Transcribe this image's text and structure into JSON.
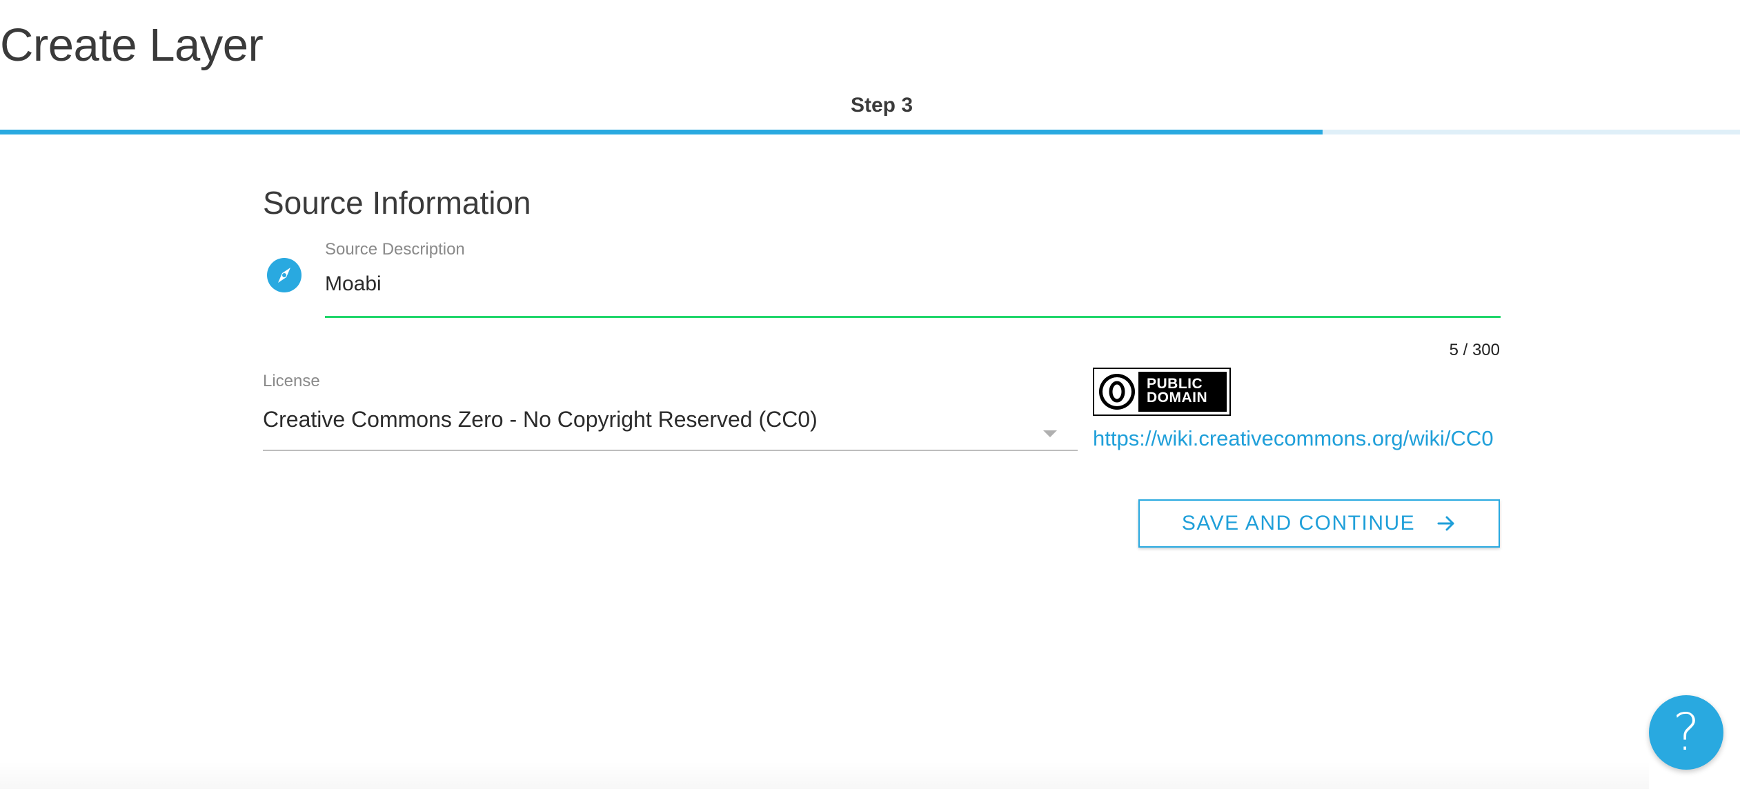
{
  "page": {
    "title": "Create Layer"
  },
  "stepper": {
    "label": "Step 3",
    "progress_fraction": 0.76,
    "fill_color": "#29a9e0",
    "track_color": "#dfeff8"
  },
  "section": {
    "title": "Source Information"
  },
  "source_description": {
    "icon": "compass-icon",
    "label": "Source Description",
    "value": "Moabi",
    "counter": "5 / 300",
    "underline_color": "#21d66b"
  },
  "license": {
    "label": "License",
    "selected": "Creative Commons Zero - No Copyright Reserved (CC0)",
    "badge_line1": "PUBLIC",
    "badge_line2": "DOMAIN",
    "badge_symbol": "0",
    "link": "https://wiki.creativecommons.org/wiki/CC0"
  },
  "actions": {
    "save_label": "SAVE AND CONTINUE",
    "save_icon": "arrow-right-icon"
  },
  "help": {
    "label": "?",
    "icon": "help-icon"
  },
  "colors": {
    "accent": "#29a9e0",
    "link": "#1f9fd9",
    "success": "#21d66b"
  }
}
